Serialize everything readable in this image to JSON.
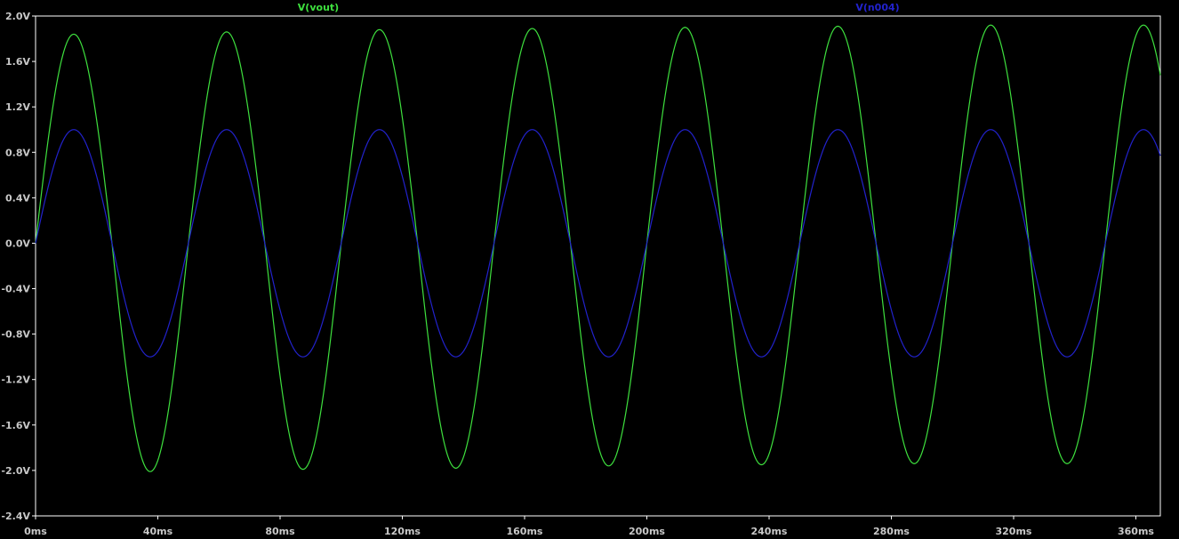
{
  "chart_data": {
    "type": "line",
    "title": "",
    "xlabel": "",
    "ylabel": "",
    "x_unit": "ms",
    "y_unit": "V",
    "xlim": [
      0,
      368
    ],
    "ylim": [
      -2.4,
      2.0
    ],
    "grid": false,
    "legend": "top",
    "x_ticks": [
      "0ms",
      "40ms",
      "80ms",
      "120ms",
      "160ms",
      "200ms",
      "240ms",
      "280ms",
      "320ms",
      "360ms"
    ],
    "y_ticks": [
      "2.0V",
      "1.6V",
      "1.2V",
      "0.8V",
      "0.4V",
      "0.0V",
      "-0.4V",
      "-0.8V",
      "-1.2V",
      "-1.6V",
      "-2.0V",
      "-2.4V"
    ],
    "series": [
      {
        "name": "V(vout)",
        "color": "#3ee03e",
        "waveform": "sine",
        "frequency_hz": 20,
        "peak_positive_v": [
          1.84,
          1.86,
          1.88,
          1.89,
          1.9,
          1.91,
          1.92,
          1.92
        ],
        "peak_negative_v": [
          -2.01,
          -1.99,
          -1.98,
          -1.96,
          -1.95,
          -1.94,
          -1.94
        ],
        "points": [
          [
            0,
            0
          ],
          [
            12.5,
            1.84
          ],
          [
            37.5,
            -2.01
          ],
          [
            62.5,
            1.86
          ],
          [
            87.5,
            -1.99
          ],
          [
            112.5,
            1.88
          ],
          [
            137.5,
            -1.98
          ],
          [
            162.5,
            1.89
          ],
          [
            187.5,
            -1.96
          ],
          [
            212.5,
            1.9
          ],
          [
            237.5,
            -1.95
          ],
          [
            262.5,
            1.91
          ],
          [
            287.5,
            -1.94
          ],
          [
            312.5,
            1.92
          ],
          [
            337.5,
            -1.94
          ],
          [
            362.5,
            1.92
          ],
          [
            368,
            1.6
          ]
        ]
      },
      {
        "name": "V(n004)",
        "color": "#2222cc",
        "waveform": "sine",
        "frequency_hz": 20,
        "amplitude_v": 1.0,
        "points": [
          [
            0,
            0
          ],
          [
            12.5,
            1.0
          ],
          [
            37.5,
            -1.0
          ],
          [
            62.5,
            1.0
          ],
          [
            87.5,
            -1.0
          ],
          [
            112.5,
            1.0
          ],
          [
            137.5,
            -1.0
          ],
          [
            162.5,
            1.0
          ],
          [
            187.5,
            -1.0
          ],
          [
            212.5,
            1.0
          ],
          [
            237.5,
            -1.0
          ],
          [
            262.5,
            1.0
          ],
          [
            287.5,
            -1.0
          ],
          [
            312.5,
            1.0
          ],
          [
            337.5,
            -1.0
          ],
          [
            362.5,
            1.0
          ],
          [
            368,
            0.85
          ]
        ]
      }
    ]
  }
}
